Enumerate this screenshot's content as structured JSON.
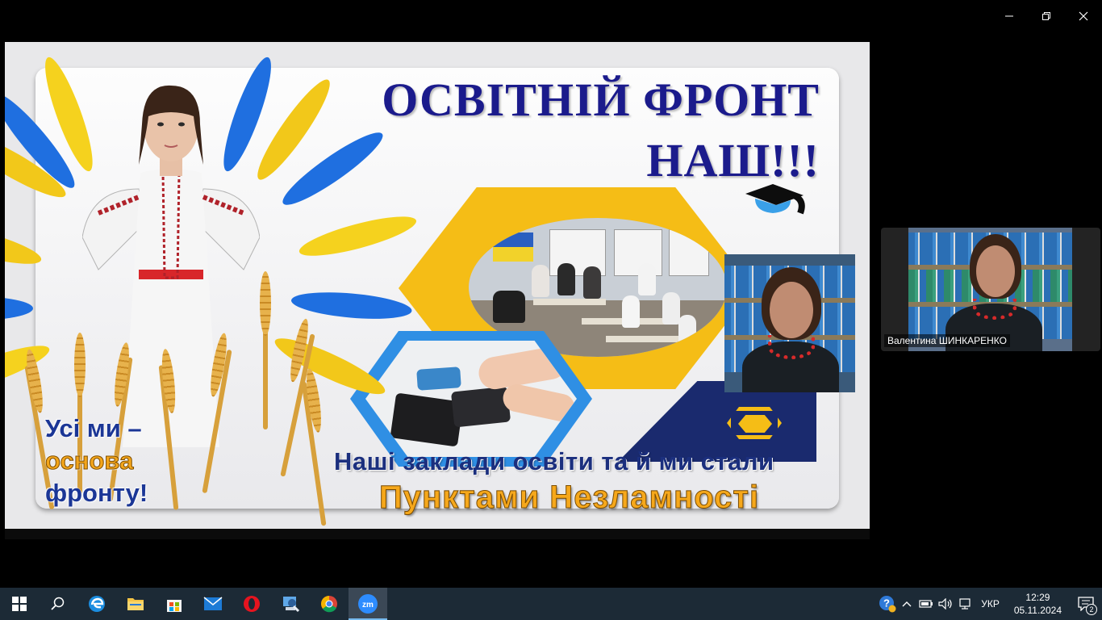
{
  "window": {
    "controls": [
      "minimize-icon",
      "restore-icon",
      "close-icon"
    ]
  },
  "slide": {
    "title_line1": "ОСВІТНІЙ ФРОНТ",
    "title_line2": "НАШ!!!",
    "slogan_line1": "Усі ми –",
    "slogan_line2": "основа",
    "slogan_line3": "фронту!",
    "bottom_line1": "Наші заклади освіти та й ми стали",
    "bottom_line2": "Пунктами Незламності",
    "colors": {
      "title": "#1b1b8c",
      "accent_yellow": "#f5bd16",
      "accent_blue": "#2f8fe4",
      "navy": "#1a2a6e"
    }
  },
  "participant": {
    "name": "Валентина ШИНКАРЕНКО"
  },
  "taskbar": {
    "apps": [
      "windows-start-icon",
      "search-icon",
      "edge-icon",
      "file-explorer-icon",
      "microsoft-store-icon",
      "mail-icon",
      "opera-icon",
      "network-tool-icon",
      "chrome-icon",
      "zoom-icon"
    ],
    "language": "УКР",
    "time": "12:29",
    "date": "05.11.2024",
    "notification_count": "2"
  }
}
